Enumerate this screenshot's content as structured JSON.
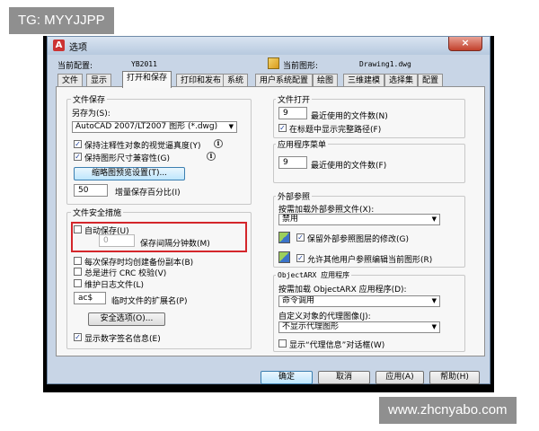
{
  "watermark_top": "TG: MYYJJPP",
  "watermark_bottom": "www.zhcnyabo.com",
  "dialog": {
    "title": "选项",
    "close_glyph": "×",
    "current_profile_label": "当前配置:",
    "current_profile_value": "YB2011",
    "current_drawing_label": "当前图形:",
    "current_drawing_value": "Drawing1.dwg"
  },
  "tabs": [
    {
      "label": "文件"
    },
    {
      "label": "显示"
    },
    {
      "label": "打开和保存"
    },
    {
      "label": "打印和发布"
    },
    {
      "label": "系统"
    },
    {
      "label": "用户系统配置"
    },
    {
      "label": "绘图"
    },
    {
      "label": "三维建模"
    },
    {
      "label": "选择集"
    },
    {
      "label": "配置"
    }
  ],
  "active_tab": "打开和保存",
  "file_save": {
    "group_title": "文件保存",
    "saveas_label": "另存为(S):",
    "saveas_value": "AutoCAD 2007/LT2007 图形 (*.dwg)",
    "keep_visual_fidelity": "保持注释性对象的视觉逼真度(Y)",
    "keep_drawing_size": "保持图形尺寸兼容性(G)",
    "thumbnail_button": "缩略图预览设置(T)...",
    "incremental_value": "50",
    "incremental_label": "增量保存百分比(I)"
  },
  "file_safety": {
    "group_title": "文件安全措施",
    "autosave_label": "自动保存(U)",
    "autosave_minutes_value": "0",
    "autosave_minutes_label": "保存间隔分钟数(M)",
    "backup_each_save": "每次保存时均创建备份副本(B)",
    "crc_check": "总是进行 CRC 校验(V)",
    "maintain_log": "维护日志文件(L)",
    "temp_ext_value": "ac$",
    "temp_ext_label": "临时文件的扩展名(P)",
    "security_button": "安全选项(O)...",
    "digital_signature": "显示数字签名信息(E)"
  },
  "file_open": {
    "group_title": "文件打开",
    "recent_value": "9",
    "recent_label": "最近使用的文件数(N)",
    "show_full_path": "在标题中显示完整路径(F)"
  },
  "app_menu": {
    "group_title": "应用程序菜单",
    "recent_value": "9",
    "recent_label": "最近使用的文件数(F)"
  },
  "xref": {
    "group_title": "外部参照",
    "demand_load_label": "按需加载外部参照文件(X):",
    "demand_load_value": "禁用",
    "retain_changes": "保留外部参照图层的修改(G)",
    "allow_edit": "允许其他用户参照编辑当前图形(R)"
  },
  "objectarx": {
    "group_title": "ObjectARX 应用程序",
    "demand_load_label": "按需加载 ObjectARX 应用程序(D):",
    "demand_load_value": "命令调用",
    "proxy_images_label": "自定义对象的代理图像(J):",
    "proxy_images_value": "不显示代理图形",
    "show_proxy_dialog": "显示“代理信息”对话框(W)"
  },
  "footer": {
    "ok": "确定",
    "cancel": "取消",
    "apply": "应用(A)",
    "help": "帮助(H)"
  },
  "check_glyph": "✓",
  "info_glyph": "i",
  "arrow_glyph": "▼"
}
